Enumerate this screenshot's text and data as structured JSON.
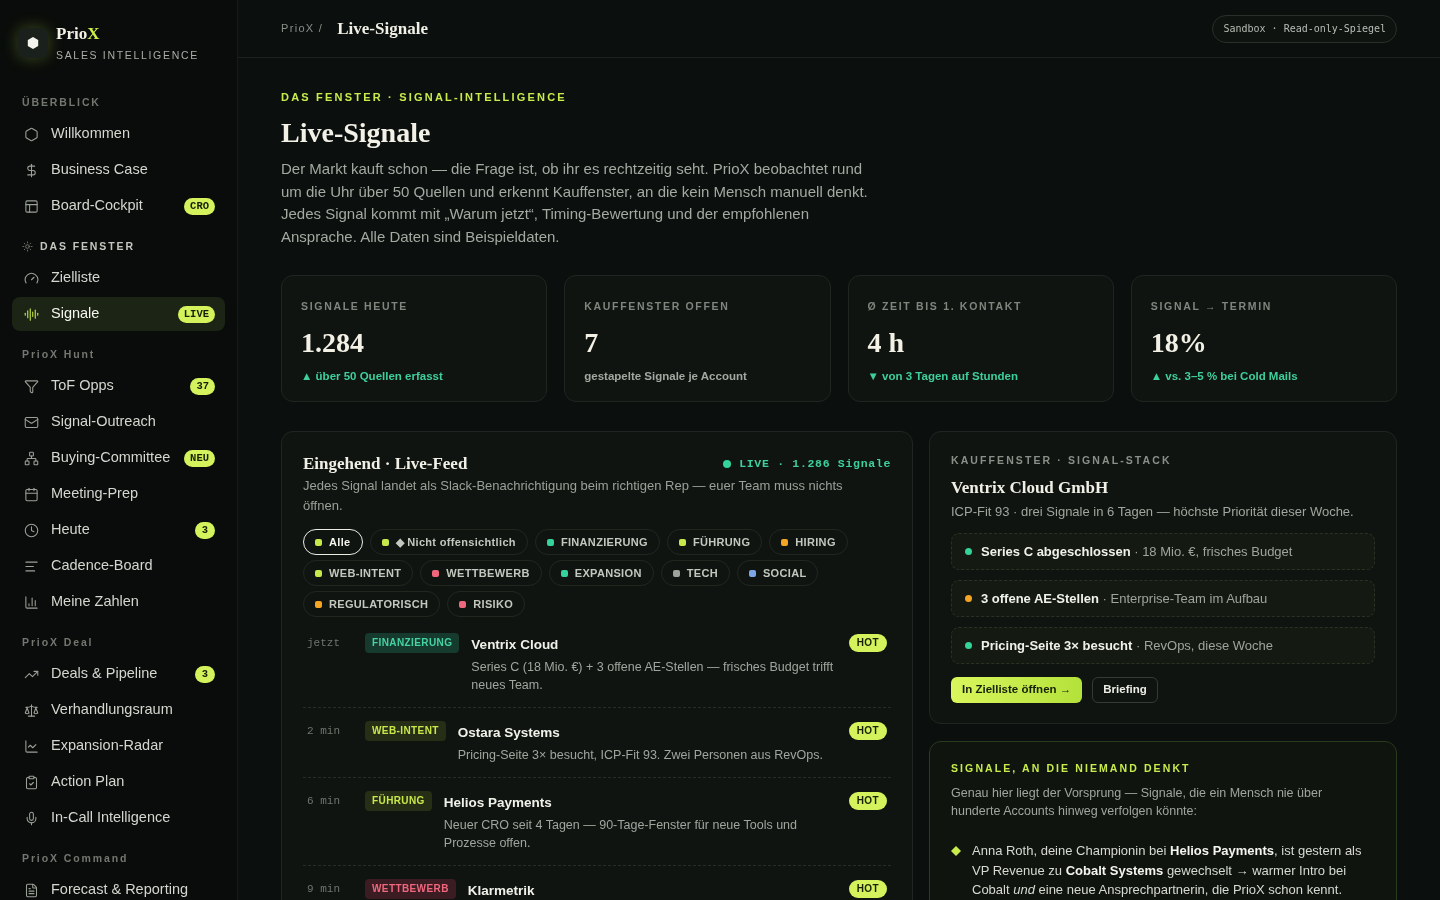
{
  "brand": {
    "name": "Prio",
    "accent": "X",
    "tagline": "SALES INTELLIGENCE"
  },
  "sidebar": {
    "sections": [
      {
        "title": "ÜBERBLICK",
        "kind": "plain",
        "items": [
          {
            "label": "Willkommen",
            "selected": false
          },
          {
            "label": "Business Case",
            "selected": false
          },
          {
            "label": "Board-Cockpit",
            "selected": false,
            "badge": "CRO"
          }
        ]
      },
      {
        "title": "DAS FENSTER",
        "kind": "featured",
        "items": [
          {
            "label": "Zielliste",
            "selected": false
          },
          {
            "label": "Signale",
            "selected": true,
            "badge": "LIVE"
          }
        ]
      },
      {
        "title": "PrioX Hunt",
        "kind": "plain",
        "items": [
          {
            "label": "ToF Opps",
            "selected": false,
            "badge": "37"
          },
          {
            "label": "Signal-Outreach",
            "selected": false
          },
          {
            "label": "Buying-Committee",
            "selected": false,
            "badge": "NEU"
          },
          {
            "label": "Meeting-Prep",
            "selected": false
          },
          {
            "label": "Heute",
            "selected": false,
            "badge": "3"
          },
          {
            "label": "Cadence-Board",
            "selected": false
          },
          {
            "label": "Meine Zahlen",
            "selected": false
          }
        ]
      },
      {
        "title": "PrioX Deal",
        "kind": "plain",
        "items": [
          {
            "label": "Deals & Pipeline",
            "selected": false,
            "badge": "3"
          },
          {
            "label": "Verhandlungsraum",
            "selected": false
          },
          {
            "label": "Expansion-Radar",
            "selected": false
          },
          {
            "label": "Action Plan",
            "selected": false
          },
          {
            "label": "In-Call Intelligence",
            "selected": false
          }
        ]
      },
      {
        "title": "PrioX Command",
        "kind": "plain",
        "items": [
          {
            "label": "Forecast & Reporting",
            "selected": false
          }
        ]
      }
    ]
  },
  "header": {
    "breadcrumb": "PrioX /",
    "title": "Live-Signale",
    "mode_pill": "Sandbox · Read-only-Spiegel"
  },
  "hero": {
    "eyebrow": "DAS FENSTER · SIGNAL-INTELLIGENCE",
    "title": "Live-Signale",
    "text": "Der Markt kauft schon — die Frage ist, ob ihr es rechtzeitig seht. PrioX beobachtet rund um die Uhr über 50 Quellen und erkennt Kauffenster, an die kein Mensch manuell denkt. Jedes Signal kommt mit „Warum jetzt“, Timing-Bewertung und der empfohlenen Ansprache. Alle Daten sind Beispieldaten."
  },
  "stats": [
    {
      "label": "SIGNALE HEUTE",
      "value": "1.284",
      "note": "▲ über 50 Quellen erfasst",
      "positive": true
    },
    {
      "label": "KAUFFENSTER OFFEN",
      "value": "7",
      "note": "gestapelte Signale je Account",
      "positive": false
    },
    {
      "label": "Ø ZEIT BIS 1. KONTAKT",
      "value": "4 h",
      "note": "▼ von 3 Tagen auf Stunden",
      "positive": true
    },
    {
      "label": "SIGNAL → TERMIN",
      "value": "18%",
      "note": "▲ vs. 3–5 % bei Cold Mails",
      "positive": true
    }
  ],
  "feed": {
    "title": "Eingehend · Live-Feed",
    "status": "LIVE · 1.286 Signale",
    "description": "Jedes Signal landet als Slack-Benachrichtigung beim richtigen Rep — euer Team muss nichts öffnen.",
    "chips": [
      {
        "label": "Alle",
        "color": "#c6e84a",
        "selected": true
      },
      {
        "label": "◆ Nicht offensichtlich",
        "color": "#c6e84a",
        "selected": false
      },
      {
        "label": "FINANZIERUNG",
        "color": "#34d399",
        "selected": false
      },
      {
        "label": "FÜHRUNG",
        "color": "#c6e84a",
        "selected": false
      },
      {
        "label": "HIRING",
        "color": "#f5a524",
        "selected": false
      },
      {
        "label": "WEB-INTENT",
        "color": "#c6e84a",
        "selected": false
      },
      {
        "label": "WETTBEWERB",
        "color": "#f0677d",
        "selected": false
      },
      {
        "label": "EXPANSION",
        "color": "#34d399",
        "selected": false
      },
      {
        "label": "TECH",
        "color": "#9ca39a",
        "selected": false
      },
      {
        "label": "SOCIAL",
        "color": "#7ea6e6",
        "selected": false
      },
      {
        "label": "REGULATORISCH",
        "color": "#f5a524",
        "selected": false
      },
      {
        "label": "RISIKO",
        "color": "#f0677d",
        "selected": false
      }
    ],
    "rows": [
      {
        "time": "jetzt",
        "tag": {
          "label": "FINANZIERUNG",
          "kind": "funding"
        },
        "company": "Ventrix Cloud",
        "text": "Series C (18 Mio. €) + 3 offene AE-Stellen — frisches Budget trifft neues Team.",
        "badge": "HOT"
      },
      {
        "time": "2 min",
        "tag": {
          "label": "WEB-INTENT",
          "kind": "intent"
        },
        "company": "Ostara Systems",
        "text": "Pricing-Seite 3× besucht, ICP-Fit 93. Zwei Personen aus RevOps.",
        "badge": "HOT"
      },
      {
        "time": "6 min",
        "tag": {
          "label": "FÜHRUNG",
          "kind": "leadership"
        },
        "company": "Helios Payments",
        "text": "Neuer CRO seit 4 Tagen — 90-Tage-Fenster für neue Tools und Prozesse offen.",
        "badge": "HOT"
      },
      {
        "time": "9 min",
        "tag": {
          "label": "WETTBEWERB",
          "kind": "competition"
        },
        "company": "Klarmetrik",
        "badge": "HOT"
      }
    ]
  },
  "signal_stack": {
    "eyebrow": "KAUFFENSTER · SIGNAL-STACK",
    "title": "Ventrix Cloud GmbH",
    "subtitle": "ICP-Fit 93 · drei Signale in 6 Tagen — höchste Priorität dieser Woche.",
    "items": [
      {
        "text": "**Series C abgeschlossen** · 18 Mio. €, frisches Budget",
        "color": "#34d399"
      },
      {
        "text": "**3 offene AE-Stellen** · Enterprise-Team im Aufbau",
        "color": "#f5a524"
      },
      {
        "text": "**Pricing-Seite 3× besucht** · RevOps, diese Woche",
        "color": "#34d399"
      }
    ],
    "buttons": [
      {
        "label": "In Zielliste öffnen →",
        "kind": "primary"
      },
      {
        "label": "Briefing",
        "kind": "secondary"
      }
    ]
  },
  "hidden_signals": {
    "eyebrow": "SIGNALE, AN DIE NIEMAND DENKT",
    "text": "Genau hier liegt der Vorsprung — Signale, die ein Mensch nie über hunderte Accounts hinweg verfolgen könnte:",
    "bullets": [
      "Anna Roth, deine Championin bei **Helios Payments**, ist gestern als VP Revenue zu **Cobalt Systems** gewechselt → warmer Intro bei Cobalt *und* eine neue Ansprechpartnerin, die PrioX schon kennt."
    ]
  }
}
